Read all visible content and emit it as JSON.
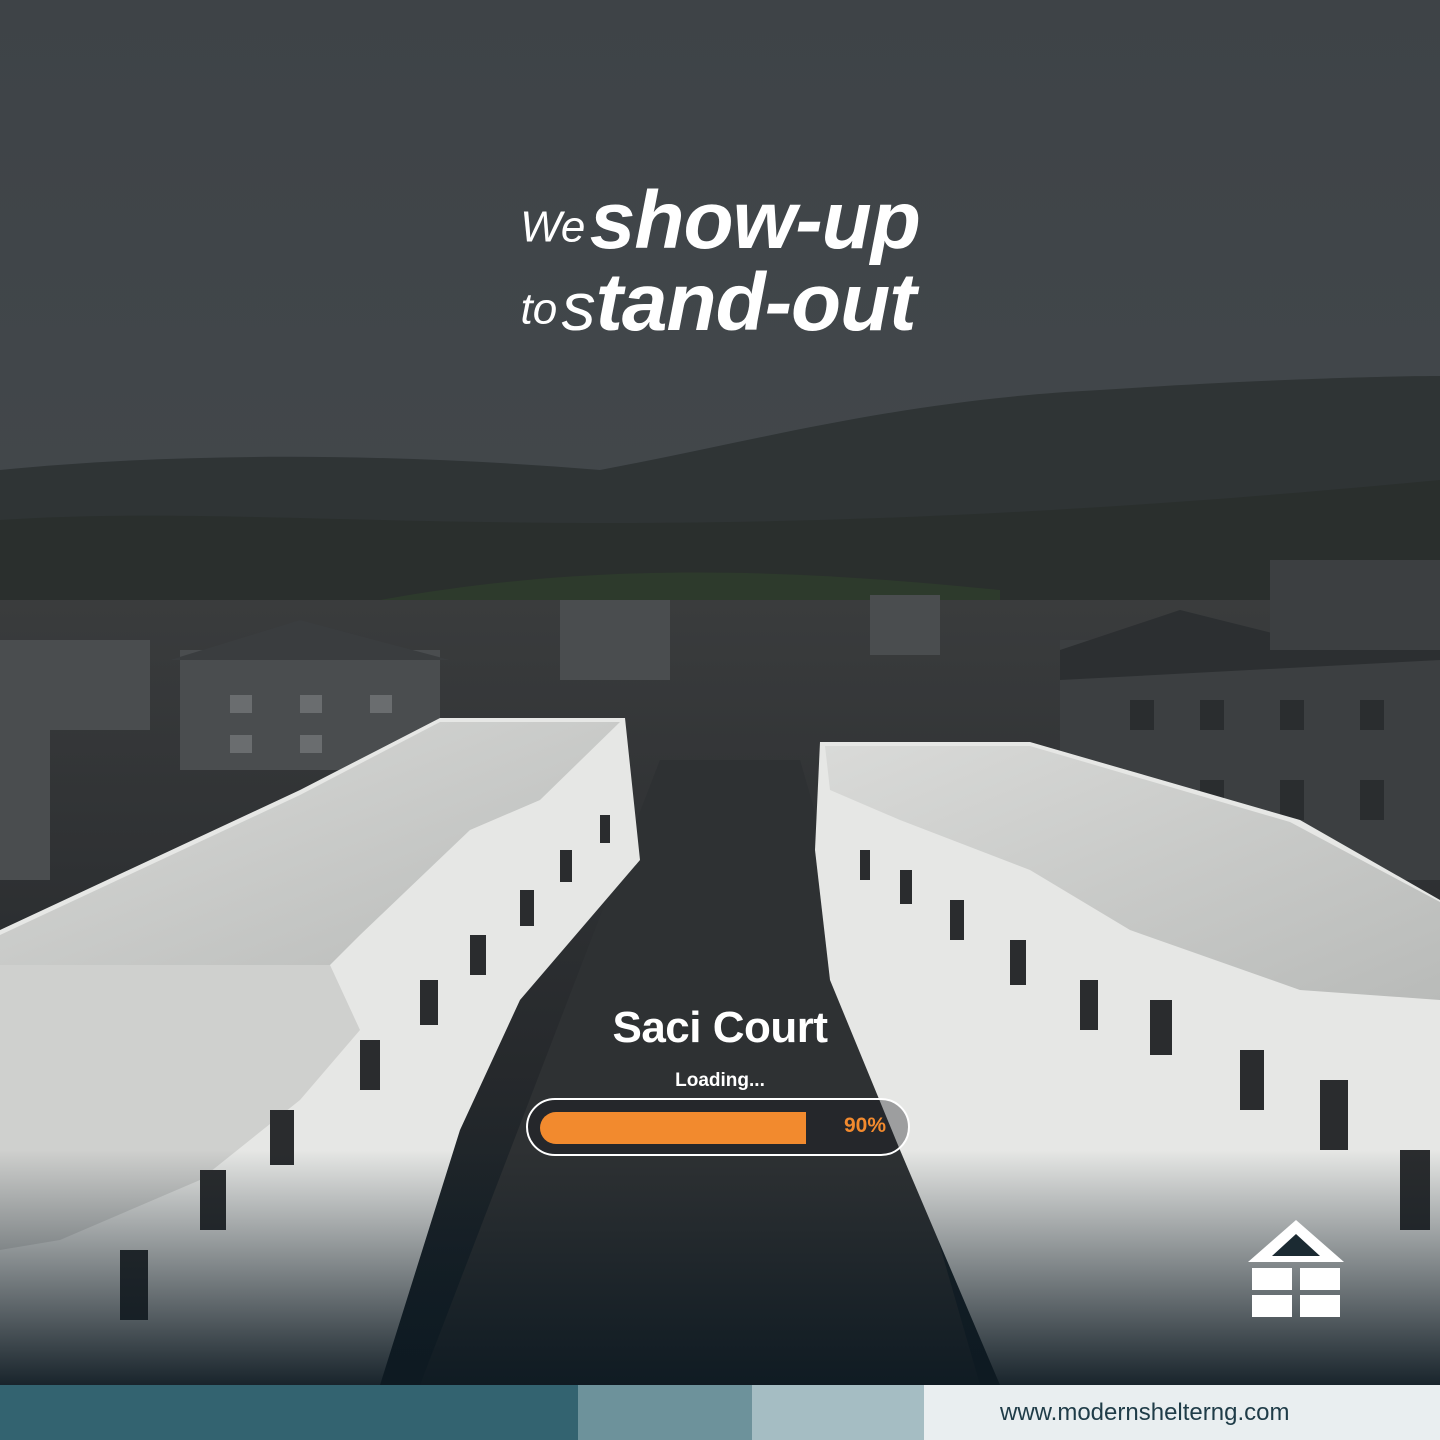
{
  "headline": {
    "line1_small": "We",
    "line1_big": "show-up",
    "line2_small": "to",
    "line2_s": "s",
    "line2_big": "tand-out"
  },
  "property": {
    "title": "Saci Court",
    "loading_label": "Loading...",
    "progress_percent": 90,
    "progress_text": "90%"
  },
  "footer": {
    "website": "www.modernshelterng.com"
  },
  "colors": {
    "background": "#3f4448",
    "accent_orange": "#f28a2e",
    "footer_teal": "#336370",
    "footer_mid": "#6d929b",
    "footer_light": "#a5bdc3",
    "footer_pale": "#e9eef0"
  },
  "icons": {
    "brand_logo": "house-window-logo"
  }
}
